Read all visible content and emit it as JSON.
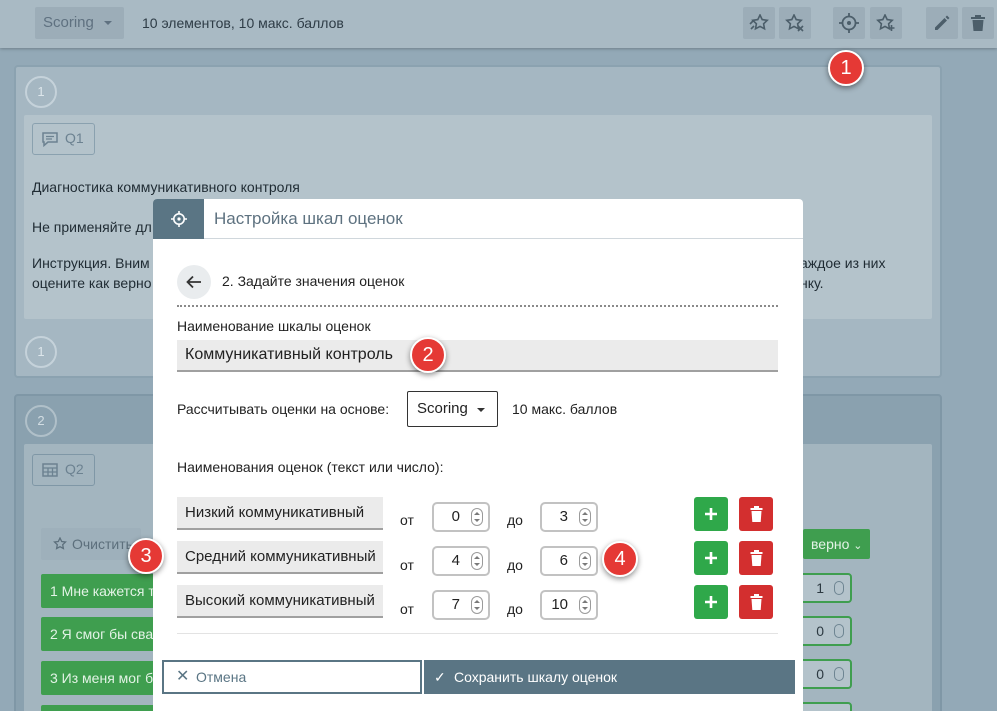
{
  "topbar": {
    "select_value": "Scoring",
    "info": "10 элементов, 10 макс. баллов",
    "icons": [
      "stars-icon",
      "star-x-icon",
      "crosshair-icon",
      "star-add-icon",
      "pencil-icon",
      "trash-icon"
    ]
  },
  "background": {
    "card1": {
      "number_top": "1",
      "number_bottom": "1",
      "tag": "Q1",
      "title": "Диагностика коммуникативного контроля",
      "line2": "Не применяйте дл",
      "line3_left": "Инструкция. Вним",
      "line3_right": "аждое из них",
      "line4_left": "оцените как верно",
      "line4_right": "нку."
    },
    "card2": {
      "number": "2",
      "tag": "Q2",
      "clear_label": "Очистить",
      "right_button": "верно",
      "items": [
        {
          "label": "1 Мне кажется т",
          "value": "1"
        },
        {
          "label": "2 Я смог бы сва",
          "value": "0"
        },
        {
          "label": "3 Из меня мог б",
          "value": "0"
        }
      ]
    }
  },
  "modal": {
    "title": "Настройка шкал оценок",
    "step": "2. Задайте значения оценок",
    "scale_name_label": "Наименование шкалы оценок",
    "scale_name_value": "Коммуникативный контроль",
    "calc_label": "Рассчитывать оценки на основе:",
    "calc_select": "Scoring",
    "calc_max": "10 макс. баллов",
    "grades_label": "Наименования оценок (текст или число):",
    "from_label": "от",
    "to_label": "до",
    "grades": [
      {
        "name": "Низкий коммуникативный",
        "from": "0",
        "to": "3"
      },
      {
        "name": "Средний коммуникативный",
        "from": "4",
        "to": "6"
      },
      {
        "name": "Высокий коммуникативный",
        "from": "7",
        "to": "10"
      }
    ],
    "cancel_label": "Отмена",
    "save_label": "Сохранить шкалу оценок"
  },
  "callouts": [
    "1",
    "2",
    "3",
    "4"
  ],
  "colors": {
    "accent": "#5a7584",
    "add": "#2fa84a",
    "delete": "#d32f2f",
    "callout": "#e53935"
  }
}
